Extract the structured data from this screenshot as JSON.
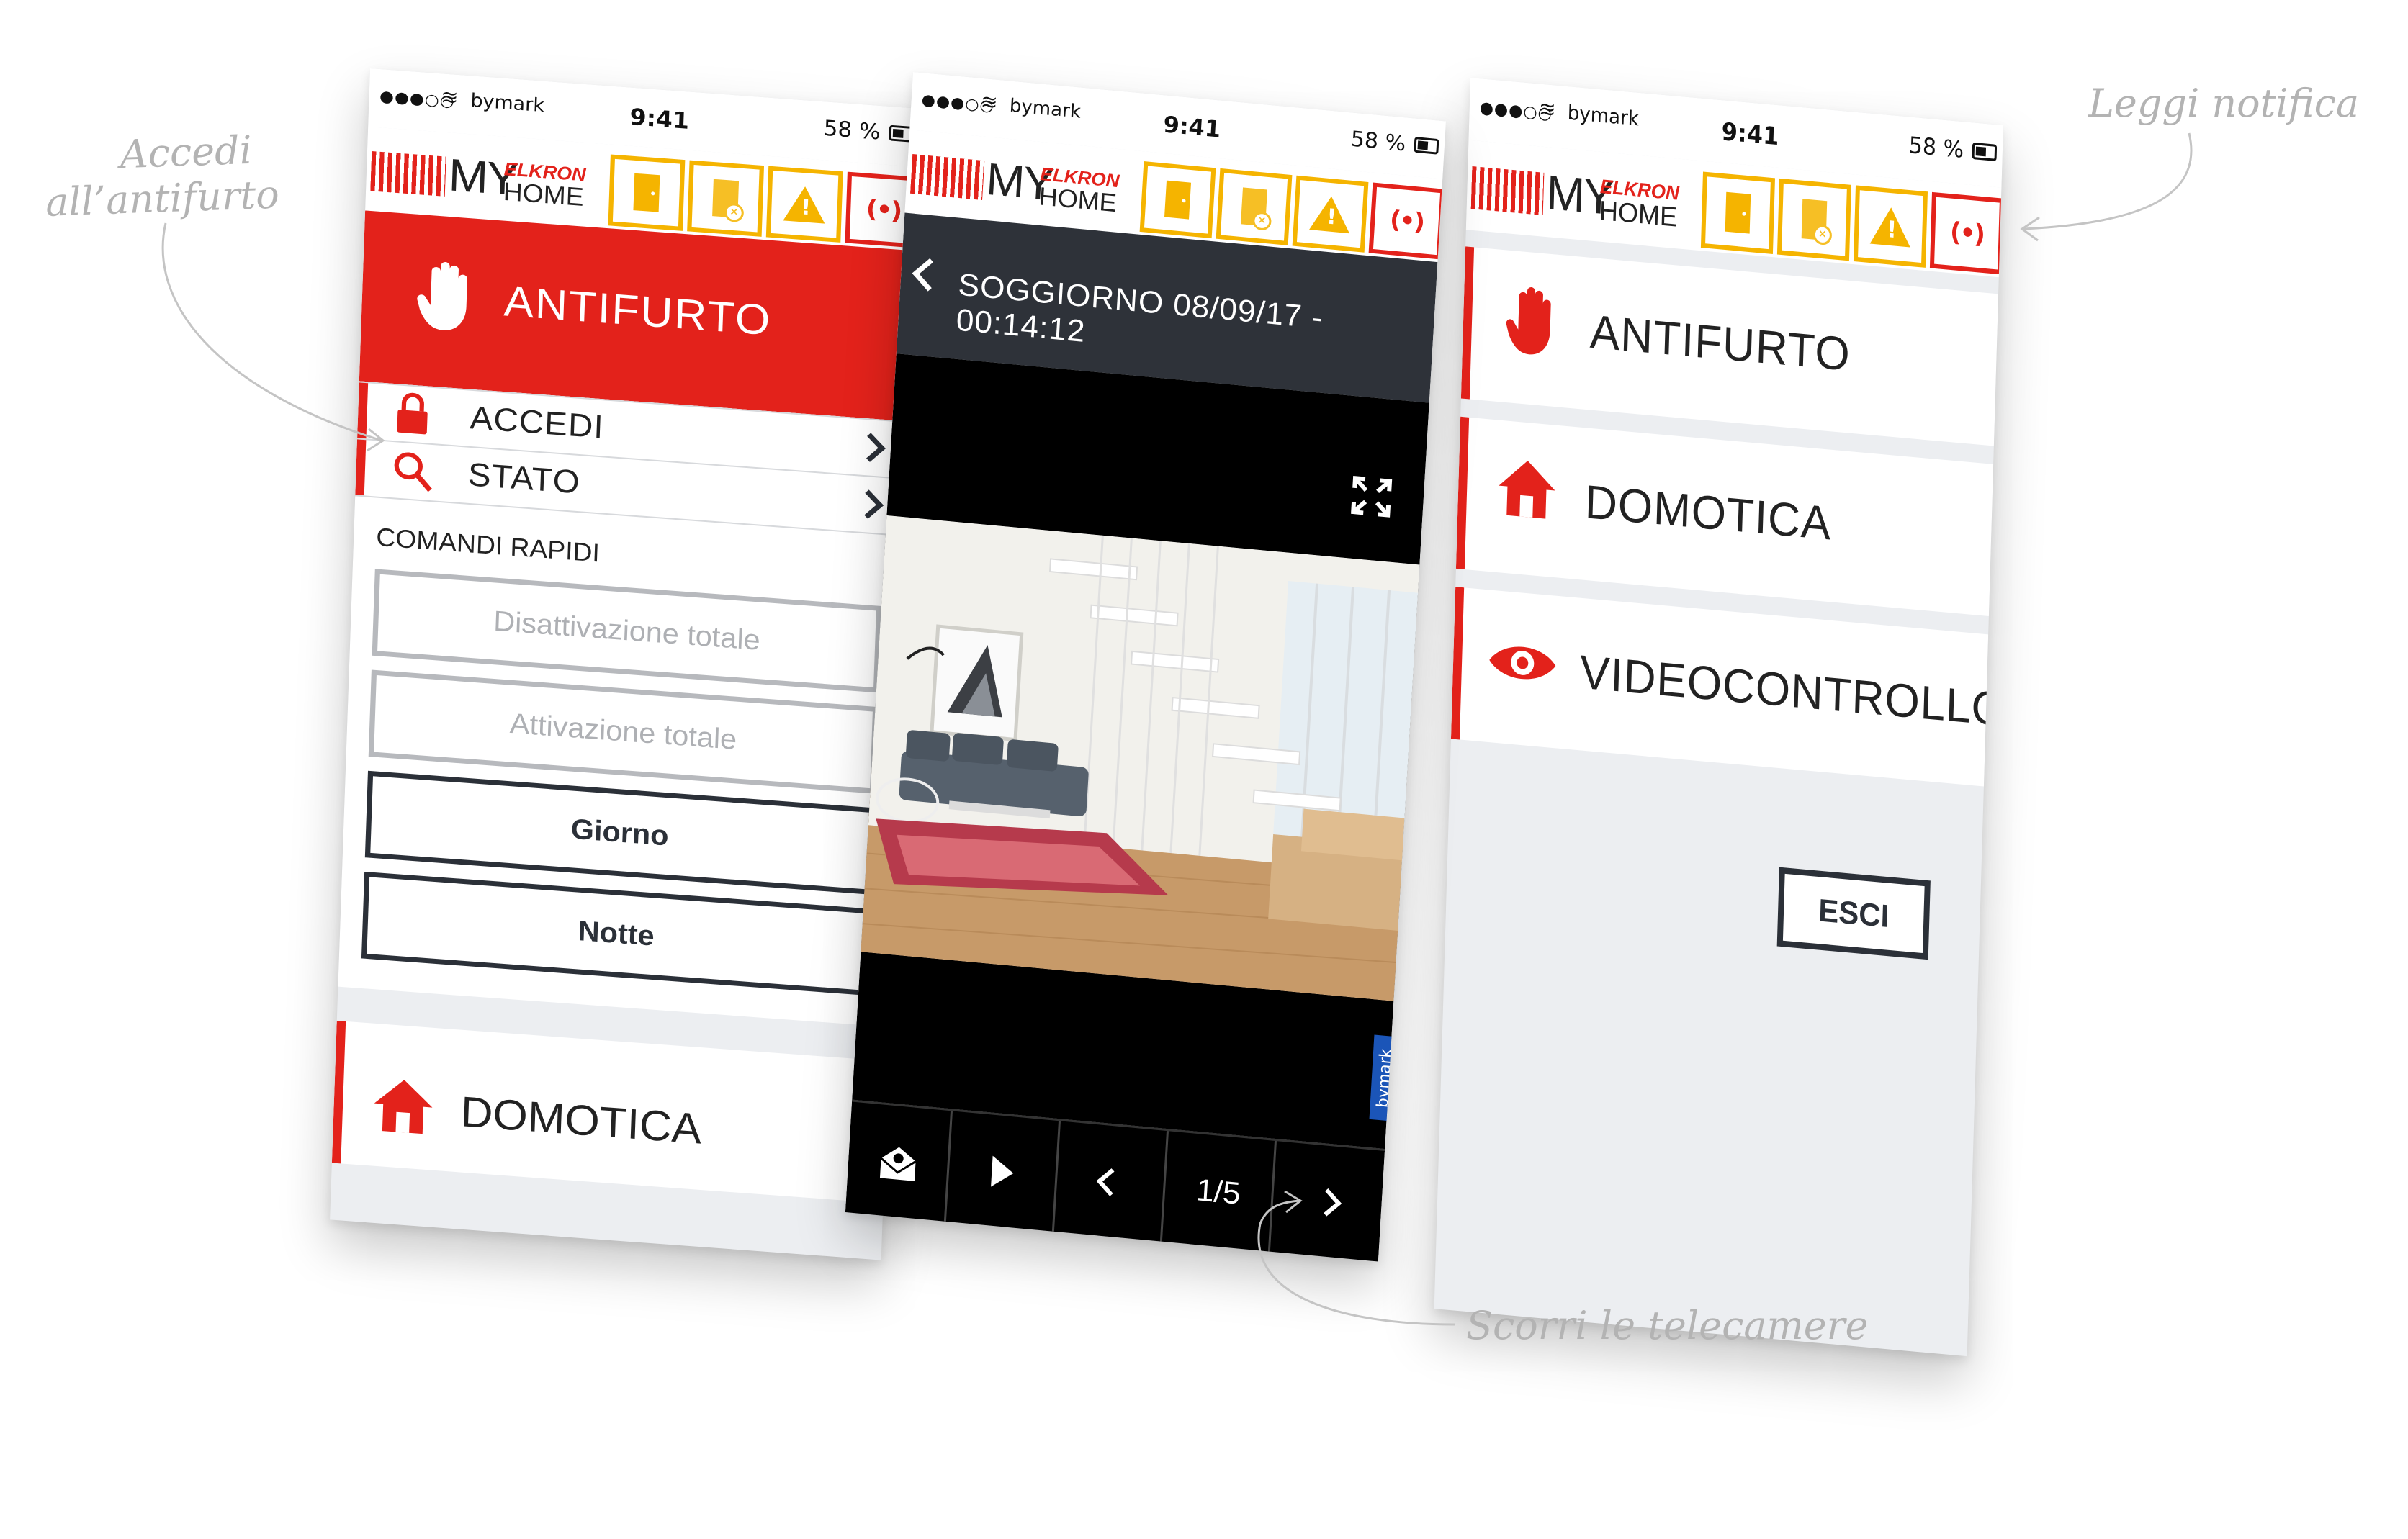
{
  "status_bar": {
    "carrier": "bymark",
    "time": "9:41",
    "battery": "58 %"
  },
  "logo": {
    "my": "MY",
    "elkron": "ELKRON",
    "home": "HOME"
  },
  "header_icons": [
    "door-open-icon",
    "door-excluded-icon",
    "warning-icon",
    "siren-alarm-icon"
  ],
  "phone1": {
    "section_title": "ANTIFURTO",
    "rows": [
      {
        "label": "ACCEDI"
      },
      {
        "label": "STATO"
      }
    ],
    "quick_title": "COMANDI RAPIDI",
    "quick_buttons": [
      "Disattivazione totale",
      "Attivazione totale",
      "Giorno",
      "Notte"
    ],
    "next_section": "DOMOTICA"
  },
  "phone2": {
    "camera_title": "SOGGIORNO 08/09/17 - 00:14:12",
    "counter": "1/5",
    "watermark": "bymark"
  },
  "phone3": {
    "menu": [
      "ANTIFURTO",
      "DOMOTICA",
      "VIDEOCONTROLLO"
    ],
    "exit_label": "ESCI"
  },
  "annotations": {
    "accedi": [
      "Accedi",
      "all’antifurto"
    ],
    "leggi": "Leggi notifica",
    "scorri": "Scorri le telecamere"
  },
  "colors": {
    "brand_red": "#e3221b",
    "warning_yellow": "#f5b400",
    "dark": "#2b3038"
  }
}
